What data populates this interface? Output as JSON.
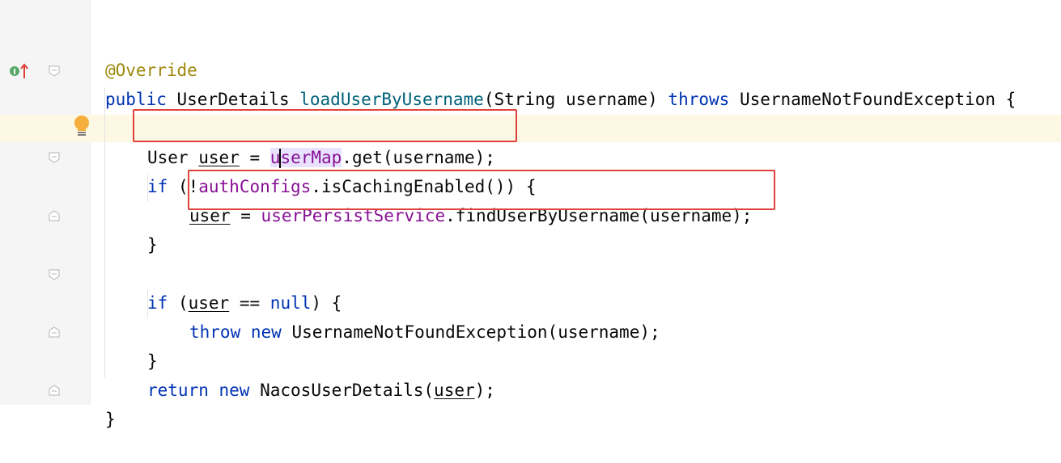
{
  "gutter": {
    "implements_marker": {
      "icon": "implements-method-icon",
      "letter": "I"
    },
    "intention_icon": "lightbulb-icon"
  },
  "code": {
    "line1": {
      "annotation": "@Override"
    },
    "line2": {
      "kw_public": "public",
      "type": "UserDetails",
      "method": "loadUserByUsername",
      "params": "(String username)",
      "kw_throws": "throws",
      "exception": "UsernameNotFoundException {"
    },
    "line3": {
      "type": "User",
      "var": "user",
      "assign": "=",
      "field_pre": "u",
      "field_post": "serMap",
      "call": ".get(username);"
    },
    "line4": {
      "kw_if": "if",
      "open": "(!",
      "field": "authConfigs",
      "call": ".isCachingEnabled()) {"
    },
    "line5": {
      "var": "user",
      "assign": "=",
      "field": "userPersistService",
      "call": ".findUserByUsername(username);"
    },
    "line6": {
      "brace": "}"
    },
    "line7": {
      "kw_if": "if",
      "open": "(",
      "var": "user",
      "op": "==",
      "kw_null": "null",
      "close": ") {"
    },
    "line8": {
      "kw_throw": "throw",
      "kw_new": "new",
      "rest": "UsernameNotFoundException(username);"
    },
    "line9": {
      "brace": "}"
    },
    "line10": {
      "kw_return": "return",
      "kw_new": "new",
      "ctor": "NacosUserDetails(",
      "var": "user",
      "close": ");"
    },
    "line11": {
      "brace": "}"
    }
  },
  "colors": {
    "keyword": "#0033b3",
    "annotation": "#9e880d",
    "method": "#00627a",
    "field": "#871094",
    "highlight_box": "#e0413a",
    "current_line": "#fcf8e3"
  }
}
